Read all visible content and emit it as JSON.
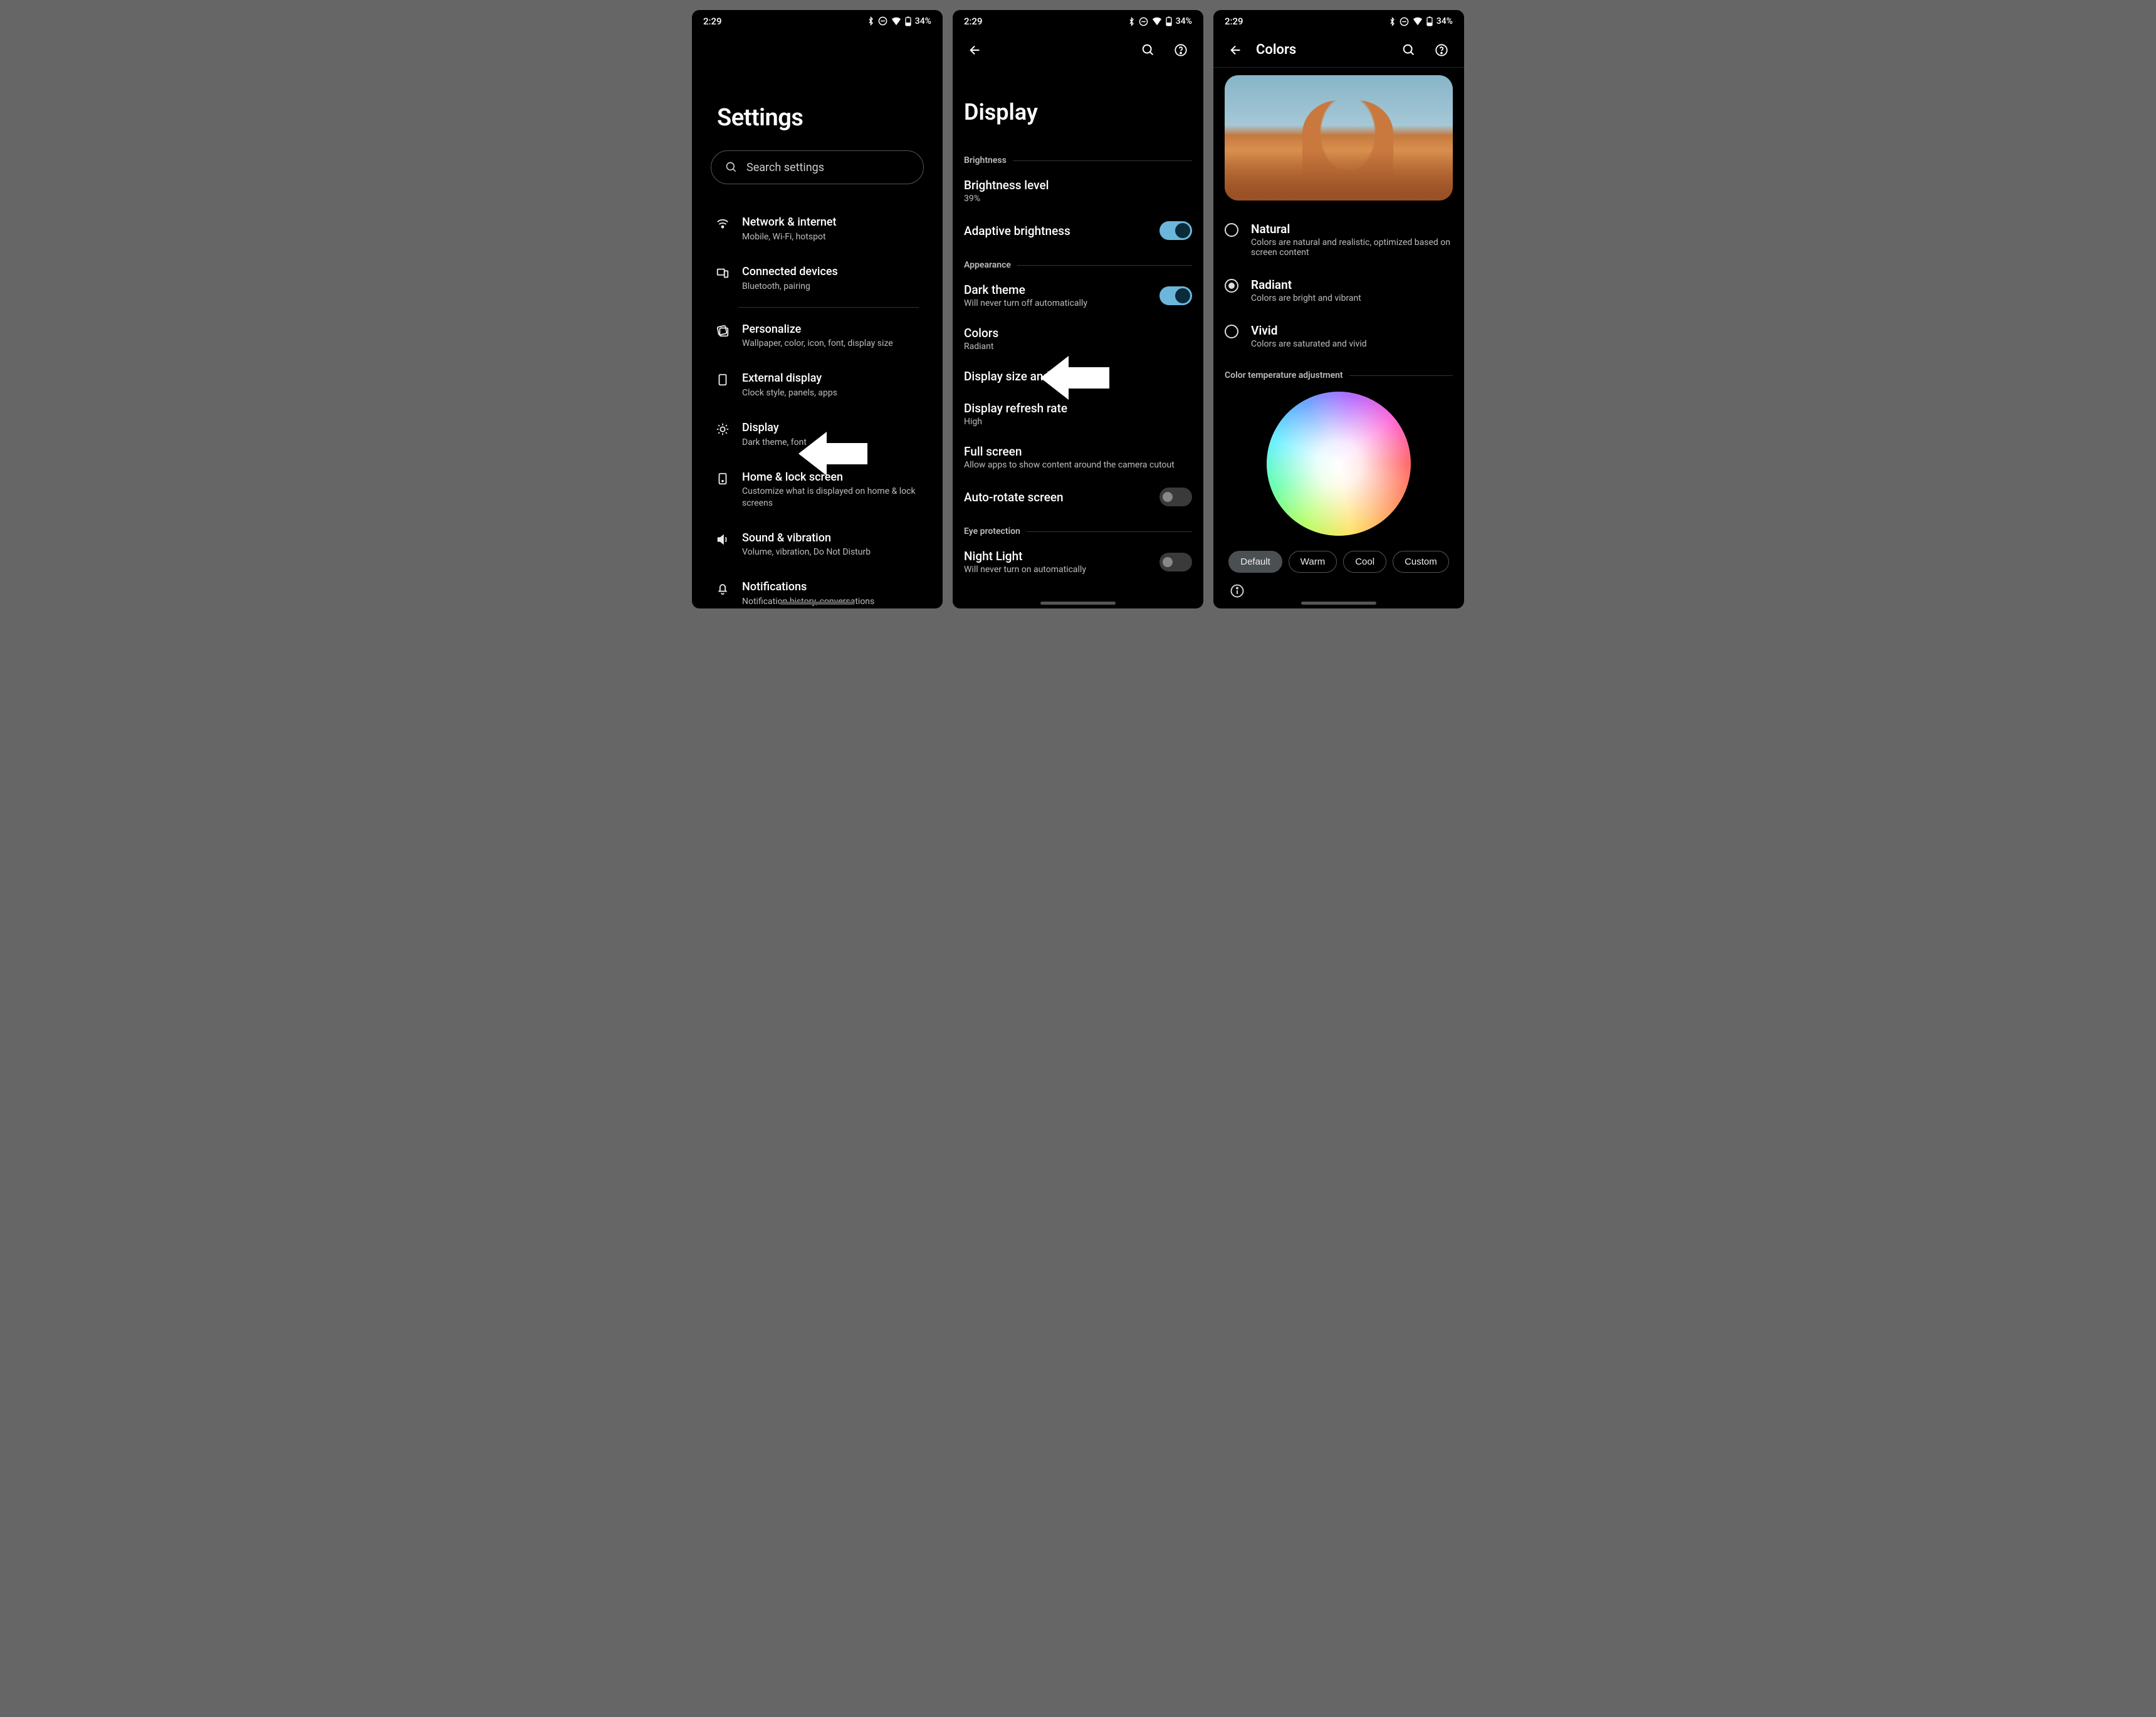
{
  "status": {
    "time": "2:29",
    "battery": "34%"
  },
  "screen1": {
    "title": "Settings",
    "search_placeholder": "Search settings",
    "items": [
      {
        "title": "Network & internet",
        "sub": "Mobile, Wi-Fi, hotspot"
      },
      {
        "title": "Connected devices",
        "sub": "Bluetooth, pairing"
      },
      {
        "title": "Personalize",
        "sub": "Wallpaper, color, icon, font, display size"
      },
      {
        "title": "External display",
        "sub": "Clock style, panels, apps"
      },
      {
        "title": "Display",
        "sub": "Dark theme, font"
      },
      {
        "title": "Home & lock screen",
        "sub": "Customize what is displayed on home & lock screens"
      },
      {
        "title": "Sound & vibration",
        "sub": "Volume, vibration, Do Not Disturb"
      },
      {
        "title": "Notifications",
        "sub": "Notification history, conversations"
      }
    ]
  },
  "screen2": {
    "title": "Display",
    "sections": {
      "brightness": "Brightness",
      "appearance": "Appearance",
      "eye": "Eye protection"
    },
    "brightness_level": {
      "t": "Brightness level",
      "s": "39%"
    },
    "adaptive": {
      "t": "Adaptive brightness"
    },
    "dark_theme": {
      "t": "Dark theme",
      "s": "Will never turn off automatically"
    },
    "colors": {
      "t": "Colors",
      "s": "Radiant"
    },
    "display_size": {
      "t": "Display size and text"
    },
    "refresh": {
      "t": "Display refresh rate",
      "s": "High"
    },
    "fullscreen": {
      "t": "Full screen",
      "s": "Allow apps to show content around the camera cutout"
    },
    "autorotate": {
      "t": "Auto-rotate screen"
    },
    "nightlight": {
      "t": "Night Light",
      "s": "Will never turn on automatically"
    }
  },
  "screen3": {
    "title": "Colors",
    "options": [
      {
        "t": "Natural",
        "s": "Colors are natural and realistic, optimized based on screen content",
        "checked": false
      },
      {
        "t": "Radiant",
        "s": "Colors are bright and vibrant",
        "checked": true
      },
      {
        "t": "Vivid",
        "s": "Colors are saturated and vivid",
        "checked": false
      }
    ],
    "temp_header": "Color temperature adjustment",
    "chips": [
      "Default",
      "Warm",
      "Cool",
      "Custom"
    ],
    "selected_chip": 0
  }
}
